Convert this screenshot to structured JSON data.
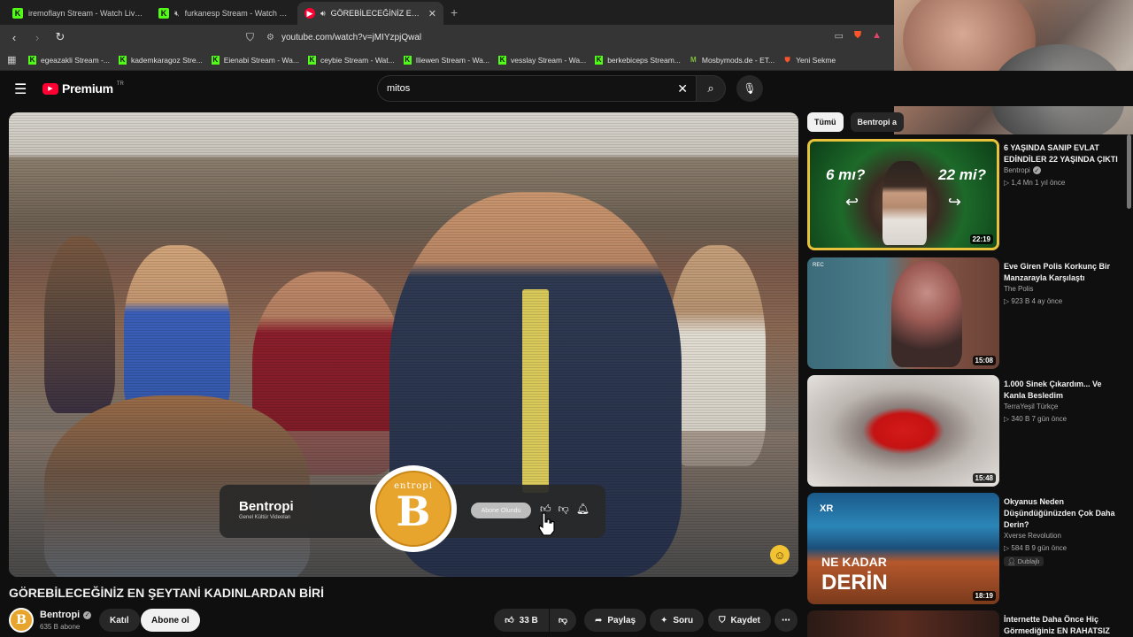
{
  "browser": {
    "tabs": [
      {
        "title": "iremoflayn Stream - Watch Live on Ki",
        "icon": "kick-icon",
        "active": false
      },
      {
        "title": "furkanesp Stream - Watch Live on",
        "icon": "kick-icon",
        "active": false
      },
      {
        "title": "GÖREBİLECEĞİNİZ EN ŞEYTANİ",
        "icon": "youtube-icon",
        "active": true
      }
    ],
    "url": "youtube.com/watch?v=jMIYzpjQwal",
    "bookmarks": [
      {
        "label": "egeazakli Stream -...",
        "icon": "kick-icon"
      },
      {
        "label": "kademkaragoz Stre...",
        "icon": "kick-icon"
      },
      {
        "label": "Eienabi Stream - Wa...",
        "icon": "kick-icon"
      },
      {
        "label": "ceybie Stream - Wat...",
        "icon": "kick-icon"
      },
      {
        "label": "Iliewen Stream - Wa...",
        "icon": "kick-icon"
      },
      {
        "label": "vesslay Stream - Wa...",
        "icon": "kick-icon"
      },
      {
        "label": "berkebiceps Stream...",
        "icon": "kick-icon"
      },
      {
        "label": "Mosbymods.de - ET...",
        "icon": "mosby-icon"
      },
      {
        "label": "Yeni Sekme",
        "icon": "brave-icon"
      }
    ]
  },
  "youtube": {
    "logo_text": "Premium",
    "logo_region": "TR",
    "search_value": "mitos"
  },
  "video": {
    "title": "GÖREBİLECEĞİNİZ EN ŞEYTANİ KADINLARDAN BİRİ",
    "overlay": {
      "channel": "Bentropi",
      "tagline": "Genel Kültür Videoları",
      "logo_text": "entropi",
      "logo_letter": "B",
      "subscribed_label": "Abone Olundu"
    },
    "channel": {
      "name": "Bentropi",
      "subs": "635 B abone",
      "join_label": "Katıl",
      "subscribe_label": "Abone ol"
    },
    "actions": {
      "likes": "33 B",
      "share": "Paylaş",
      "ask": "Soru",
      "save": "Kaydet"
    }
  },
  "sidebar": {
    "chips": [
      "Tümü",
      "Bentropi a"
    ],
    "recommendations": [
      {
        "title": "6 YAŞINDA SANIP EVLAT EDİNDİLER 22 YAŞINDA ÇIKTI",
        "channel": "Bentropi",
        "verified": true,
        "meta": "1,4 Mn  1 yıl önce",
        "duration": "22:19",
        "thumb_left": "6 mı?",
        "thumb_right": "22 mi?"
      },
      {
        "title": "Eve Giren Polis Korkunç Bir Manzarayla Karşılaştı",
        "channel": "The Polis",
        "verified": false,
        "meta": "923 B  4 ay önce",
        "duration": "15:08",
        "thumb_left": "REC"
      },
      {
        "title": "1.000 Sinek Çıkardım... Ve Kanla Besledim",
        "channel": "TerraYeşil Türkçe",
        "verified": false,
        "meta": "340 B  7 gün önce",
        "duration": "15:48"
      },
      {
        "title": "Okyanus Neden Düşündüğünüzden Çok Daha Derin?",
        "channel": "Xverse Revolution",
        "verified": false,
        "meta": "584 B  9 gün önce",
        "duration": "18:19",
        "badge": "Dublajlı",
        "thumb_top": "NE KADAR",
        "thumb_bottom": "DERİN",
        "thumb_logo": "XR"
      },
      {
        "title": "İnternette Daha Önce Hiç Görmediğiniz EN RAHATSIZ",
        "channel": "",
        "verified": false,
        "meta": "",
        "duration": ""
      }
    ]
  },
  "colors": {
    "accent": "#ff0033",
    "kick_green": "#53fc18",
    "bentropi_orange": "#e8a52e"
  }
}
